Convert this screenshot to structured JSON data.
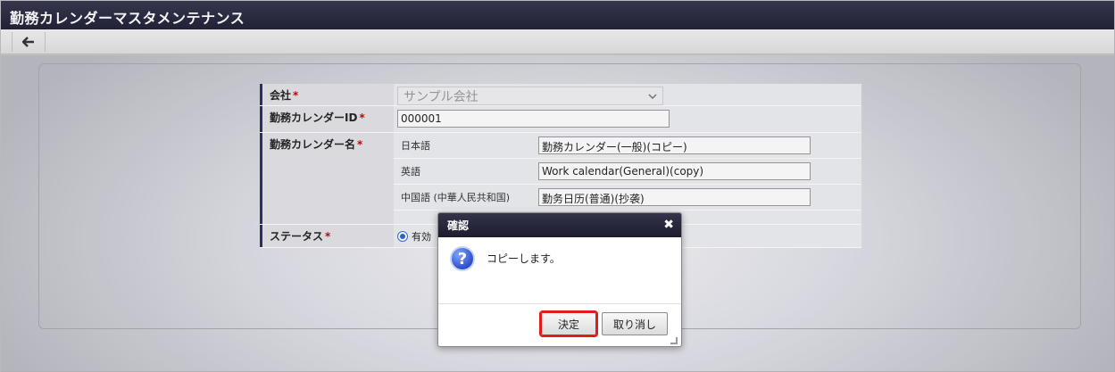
{
  "window": {
    "title": "勤務カレンダーマスタメンテナンス"
  },
  "toolbar": {
    "back_icon": "arrow-left-icon"
  },
  "form": {
    "company": {
      "label": "会社",
      "required_mark": "*",
      "value": "サンプル会社"
    },
    "calendar_id": {
      "label": "勤務カレンダーID",
      "required_mark": "*",
      "value": "000001"
    },
    "calendar_name": {
      "label": "勤務カレンダー名",
      "required_mark": "*",
      "languages": [
        {
          "label": "日本語",
          "value": "勤務カレンダー(一般)(コピー)"
        },
        {
          "label": "英語",
          "value": "Work calendar(General)(copy)"
        },
        {
          "label": "中国語 (中華人民共和国)",
          "value": "勤务日历(普通)(抄袭)"
        }
      ]
    },
    "status": {
      "label": "ステータス",
      "required_mark": "*",
      "option": "有効"
    }
  },
  "dialog": {
    "title": "確認",
    "close_icon": "close-icon",
    "message": "コピーします。",
    "ok_label": "決定",
    "cancel_label": "取り消し"
  },
  "colors": {
    "header": "#1f2036",
    "label_accent": "#2a2e63",
    "highlight": "#e21b1b"
  }
}
